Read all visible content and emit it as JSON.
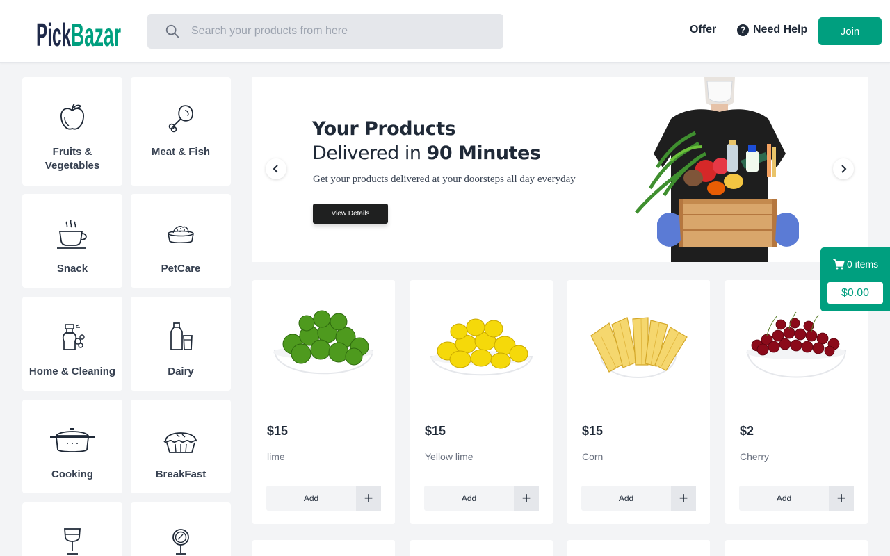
{
  "header": {
    "logo_text": "PickBazar",
    "search_placeholder": "Search your products from here",
    "offer_label": "Offer",
    "help_label": "Need Help",
    "help_icon_glyph": "?",
    "join_label": "Join"
  },
  "colors": {
    "brand": "#009f7f",
    "logo_dark": "#1f2a4a",
    "page_bg": "#f3f4f6"
  },
  "categories": [
    {
      "label_line1": "Fruits &",
      "label_line2": "Vegetables",
      "icon": "apple-icon"
    },
    {
      "label_line1": "Meat & Fish",
      "label_line2": "",
      "icon": "drumstick-icon"
    },
    {
      "label_line1": "Snack",
      "label_line2": "",
      "icon": "coffee-cup-icon"
    },
    {
      "label_line1": "PetCare",
      "label_line2": "",
      "icon": "pet-bowl-icon"
    },
    {
      "label_line1": "Home & Cleaning",
      "label_line2": "",
      "icon": "spray-bottle-icon"
    },
    {
      "label_line1": "Dairy",
      "label_line2": "",
      "icon": "milk-bottle-icon"
    },
    {
      "label_line1": "Cooking",
      "label_line2": "",
      "icon": "cooking-pot-icon"
    },
    {
      "label_line1": "BreakFast",
      "label_line2": "",
      "icon": "pie-icon"
    },
    {
      "label_line1": "",
      "label_line2": "",
      "icon": "wine-glass-icon"
    },
    {
      "label_line1": "",
      "label_line2": "",
      "icon": "mirror-icon"
    }
  ],
  "banner": {
    "title": "Your Products",
    "subtitle_prefix": "Delivered in ",
    "subtitle_bold": "90 Minutes",
    "description": "Get your products delivered at your doorsteps all day everyday",
    "button_label": "View Details"
  },
  "products": [
    {
      "price": "$15",
      "name": "lime",
      "add_label": "Add",
      "plus": "+"
    },
    {
      "price": "$15",
      "name": "Yellow lime",
      "add_label": "Add",
      "plus": "+"
    },
    {
      "price": "$15",
      "name": "Corn",
      "add_label": "Add",
      "plus": "+"
    },
    {
      "price": "$2",
      "name": "Cherry",
      "add_label": "Add",
      "plus": "+"
    }
  ],
  "cart": {
    "items_label": "0 items",
    "total": "$0.00"
  }
}
